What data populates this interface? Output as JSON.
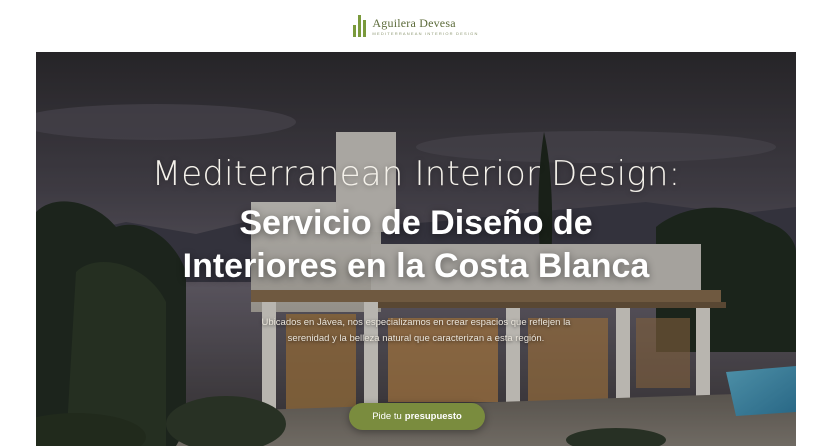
{
  "brand": {
    "name": "Aguilera Devesa",
    "tagline": "Mediterranean Interior Design",
    "accent_color": "#7a8c3e"
  },
  "hero": {
    "title_light": "Mediterranean Interior Design:",
    "title_bold_line1": "Servicio de Diseño de",
    "title_bold_line2": "Interiores en la Costa Blanca",
    "subtitle": "Ubicados en Jávea, nos especializamos en crear espacios que reflejen la serenidad y la belleza natural que caracterizan a esta región.",
    "cta_regular": "Pide tu",
    "cta_bold": "presupuesto"
  }
}
